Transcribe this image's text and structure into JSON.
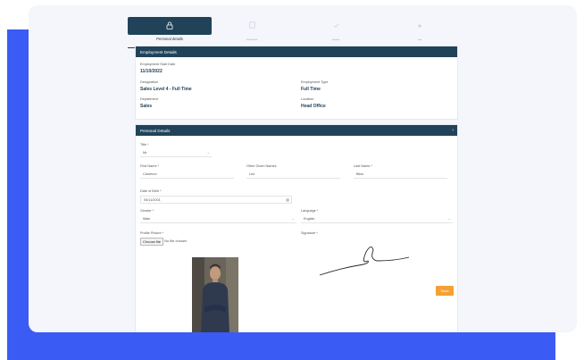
{
  "tabs": [
    {
      "label": "Personal details",
      "icon": "lock-icon"
    },
    {
      "label": "",
      "icon": "document-icon"
    },
    {
      "label": "",
      "icon": "check-icon"
    },
    {
      "label": "",
      "icon": "dot-icon"
    }
  ],
  "employment": {
    "header": "Employment Details",
    "start_date_label": "Employment Start Date",
    "start_date": "11/10/2022",
    "designation_label": "Designation",
    "designation": "Sales Level 4 - Full Time",
    "type_label": "Employment Type",
    "type": "Full Time",
    "department_label": "Department",
    "department": "Sales",
    "location_label": "Location",
    "location": "Head Office"
  },
  "personal": {
    "header": "Personal Details",
    "title_label": "Title *",
    "title_value": "Mr",
    "first_name_label": "First Name *",
    "first_name": "Cameron",
    "other_names_label": "Other Given Names",
    "other_names": "Lee",
    "last_name_label": "Last Name *",
    "last_name": "Bliss",
    "dob_label": "Date of Birth *",
    "dob": "06/11/2001",
    "gender_label": "Gender *",
    "gender": "Male",
    "language_label": "Language *",
    "language": "English",
    "picture_label": "Profile Picture *",
    "file_button": "Choose file",
    "file_status": "No file chosen",
    "signature_label": "Signature *",
    "save_label": "Save"
  },
  "colors": {
    "accent": "#20435a",
    "brand_blue": "#3b5bf5",
    "save": "#f5a033"
  }
}
